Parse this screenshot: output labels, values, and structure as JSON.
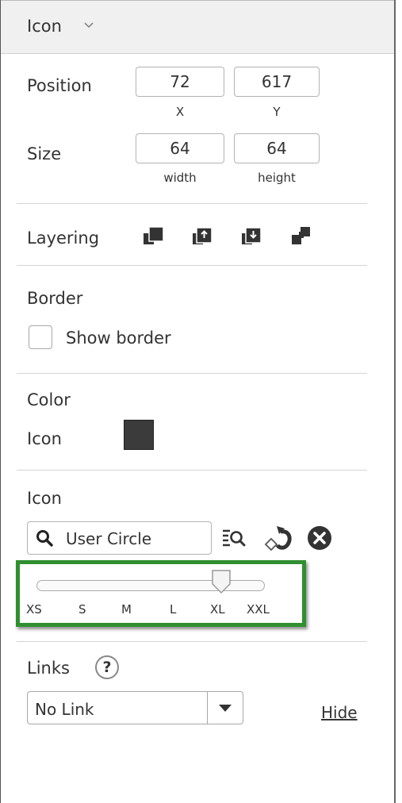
{
  "header": {
    "title": "Icon",
    "chevron": "chevron-down-icon"
  },
  "position": {
    "label": "Position",
    "x_value": "72",
    "y_value": "617",
    "x_caption": "X",
    "y_caption": "Y"
  },
  "size": {
    "label": "Size",
    "width_value": "64",
    "height_value": "64",
    "width_caption": "width",
    "height_caption": "height"
  },
  "layering": {
    "label": "Layering",
    "buttons": [
      "bring-to-front-icon",
      "bring-forward-icon",
      "send-backward-icon",
      "send-to-back-icon"
    ]
  },
  "border": {
    "heading": "Border",
    "checkbox_label": "Show border",
    "checked": false
  },
  "color": {
    "heading": "Color",
    "icon_label": "Icon",
    "icon_color": "#3b3b3b"
  },
  "icon_section": {
    "heading": "Icon",
    "search_value": "User Circle",
    "size_slider": {
      "ticks": [
        "XS",
        "S",
        "M",
        "L",
        "XL",
        "XXL"
      ],
      "selected": "XL"
    },
    "highlight_color": "#2f8f2f"
  },
  "links": {
    "heading": "Links",
    "help_text": "?",
    "select_value": "No Link",
    "hide_label": "Hide"
  }
}
